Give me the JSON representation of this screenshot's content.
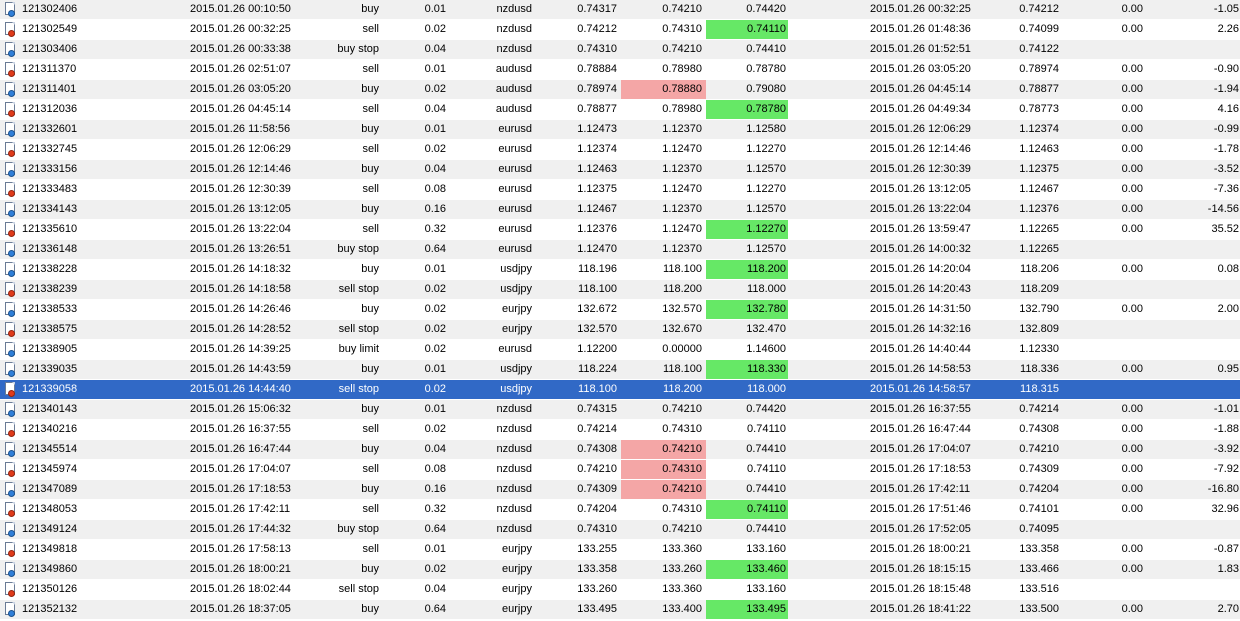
{
  "colors": {
    "row_even": "#f0f0f0",
    "row_odd": "#ffffff",
    "selected_row": "#3169c6",
    "highlight_red": "#f4a6a6",
    "highlight_green": "#66e866",
    "buy_icon": "#2f7fd8",
    "sell_icon": "#e03a1a"
  },
  "selected_ticket": "121339058",
  "rows": [
    {
      "icon": "buy",
      "ticket": "121302406",
      "open_time": "2015.01.26 00:10:50",
      "type": "buy",
      "size": "0.01",
      "symbol": "nzdusd",
      "price": "0.74317",
      "sl": "0.74210",
      "tp": "0.74420",
      "close_time": "2015.01.26 00:32:25",
      "close_price": "0.74212",
      "swap": "0.00",
      "profit": "-1.05",
      "sl_hl": "",
      "tp_hl": ""
    },
    {
      "icon": "sell",
      "ticket": "121302549",
      "open_time": "2015.01.26 00:32:25",
      "type": "sell",
      "size": "0.02",
      "symbol": "nzdusd",
      "price": "0.74212",
      "sl": "0.74310",
      "tp": "0.74110",
      "close_time": "2015.01.26 01:48:36",
      "close_price": "0.74099",
      "swap": "0.00",
      "profit": "2.26",
      "sl_hl": "",
      "tp_hl": "green"
    },
    {
      "icon": "buy",
      "ticket": "121303406",
      "open_time": "2015.01.26 00:33:38",
      "type": "buy stop",
      "size": "0.04",
      "symbol": "nzdusd",
      "price": "0.74310",
      "sl": "0.74210",
      "tp": "0.74410",
      "close_time": "2015.01.26 01:52:51",
      "close_price": "0.74122",
      "swap": "",
      "profit": "",
      "sl_hl": "",
      "tp_hl": ""
    },
    {
      "icon": "sell",
      "ticket": "121311370",
      "open_time": "2015.01.26 02:51:07",
      "type": "sell",
      "size": "0.01",
      "symbol": "audusd",
      "price": "0.78884",
      "sl": "0.78980",
      "tp": "0.78780",
      "close_time": "2015.01.26 03:05:20",
      "close_price": "0.78974",
      "swap": "0.00",
      "profit": "-0.90",
      "sl_hl": "",
      "tp_hl": ""
    },
    {
      "icon": "buy",
      "ticket": "121311401",
      "open_time": "2015.01.26 03:05:20",
      "type": "buy",
      "size": "0.02",
      "symbol": "audusd",
      "price": "0.78974",
      "sl": "0.78880",
      "tp": "0.79080",
      "close_time": "2015.01.26 04:45:14",
      "close_price": "0.78877",
      "swap": "0.00",
      "profit": "-1.94",
      "sl_hl": "red",
      "tp_hl": ""
    },
    {
      "icon": "sell",
      "ticket": "121312036",
      "open_time": "2015.01.26 04:45:14",
      "type": "sell",
      "size": "0.04",
      "symbol": "audusd",
      "price": "0.78877",
      "sl": "0.78980",
      "tp": "0.78780",
      "close_time": "2015.01.26 04:49:34",
      "close_price": "0.78773",
      "swap": "0.00",
      "profit": "4.16",
      "sl_hl": "",
      "tp_hl": "green"
    },
    {
      "icon": "buy",
      "ticket": "121332601",
      "open_time": "2015.01.26 11:58:56",
      "type": "buy",
      "size": "0.01",
      "symbol": "eurusd",
      "price": "1.12473",
      "sl": "1.12370",
      "tp": "1.12580",
      "close_time": "2015.01.26 12:06:29",
      "close_price": "1.12374",
      "swap": "0.00",
      "profit": "-0.99",
      "sl_hl": "",
      "tp_hl": ""
    },
    {
      "icon": "sell",
      "ticket": "121332745",
      "open_time": "2015.01.26 12:06:29",
      "type": "sell",
      "size": "0.02",
      "symbol": "eurusd",
      "price": "1.12374",
      "sl": "1.12470",
      "tp": "1.12270",
      "close_time": "2015.01.26 12:14:46",
      "close_price": "1.12463",
      "swap": "0.00",
      "profit": "-1.78",
      "sl_hl": "",
      "tp_hl": ""
    },
    {
      "icon": "buy",
      "ticket": "121333156",
      "open_time": "2015.01.26 12:14:46",
      "type": "buy",
      "size": "0.04",
      "symbol": "eurusd",
      "price": "1.12463",
      "sl": "1.12370",
      "tp": "1.12570",
      "close_time": "2015.01.26 12:30:39",
      "close_price": "1.12375",
      "swap": "0.00",
      "profit": "-3.52",
      "sl_hl": "",
      "tp_hl": ""
    },
    {
      "icon": "sell",
      "ticket": "121333483",
      "open_time": "2015.01.26 12:30:39",
      "type": "sell",
      "size": "0.08",
      "symbol": "eurusd",
      "price": "1.12375",
      "sl": "1.12470",
      "tp": "1.12270",
      "close_time": "2015.01.26 13:12:05",
      "close_price": "1.12467",
      "swap": "0.00",
      "profit": "-7.36",
      "sl_hl": "",
      "tp_hl": ""
    },
    {
      "icon": "buy",
      "ticket": "121334143",
      "open_time": "2015.01.26 13:12:05",
      "type": "buy",
      "size": "0.16",
      "symbol": "eurusd",
      "price": "1.12467",
      "sl": "1.12370",
      "tp": "1.12570",
      "close_time": "2015.01.26 13:22:04",
      "close_price": "1.12376",
      "swap": "0.00",
      "profit": "-14.56",
      "sl_hl": "",
      "tp_hl": ""
    },
    {
      "icon": "sell",
      "ticket": "121335610",
      "open_time": "2015.01.26 13:22:04",
      "type": "sell",
      "size": "0.32",
      "symbol": "eurusd",
      "price": "1.12376",
      "sl": "1.12470",
      "tp": "1.12270",
      "close_time": "2015.01.26 13:59:47",
      "close_price": "1.12265",
      "swap": "0.00",
      "profit": "35.52",
      "sl_hl": "",
      "tp_hl": "green"
    },
    {
      "icon": "buy",
      "ticket": "121336148",
      "open_time": "2015.01.26 13:26:51",
      "type": "buy stop",
      "size": "0.64",
      "symbol": "eurusd",
      "price": "1.12470",
      "sl": "1.12370",
      "tp": "1.12570",
      "close_time": "2015.01.26 14:00:32",
      "close_price": "1.12265",
      "swap": "",
      "profit": "",
      "sl_hl": "",
      "tp_hl": ""
    },
    {
      "icon": "buy",
      "ticket": "121338228",
      "open_time": "2015.01.26 14:18:32",
      "type": "buy",
      "size": "0.01",
      "symbol": "usdjpy",
      "price": "118.196",
      "sl": "118.100",
      "tp": "118.200",
      "close_time": "2015.01.26 14:20:04",
      "close_price": "118.206",
      "swap": "0.00",
      "profit": "0.08",
      "sl_hl": "",
      "tp_hl": "green"
    },
    {
      "icon": "sell",
      "ticket": "121338239",
      "open_time": "2015.01.26 14:18:58",
      "type": "sell stop",
      "size": "0.02",
      "symbol": "usdjpy",
      "price": "118.100",
      "sl": "118.200",
      "tp": "118.000",
      "close_time": "2015.01.26 14:20:43",
      "close_price": "118.209",
      "swap": "",
      "profit": "",
      "sl_hl": "",
      "tp_hl": ""
    },
    {
      "icon": "buy",
      "ticket": "121338533",
      "open_time": "2015.01.26 14:26:46",
      "type": "buy",
      "size": "0.02",
      "symbol": "eurjpy",
      "price": "132.672",
      "sl": "132.570",
      "tp": "132.780",
      "close_time": "2015.01.26 14:31:50",
      "close_price": "132.790",
      "swap": "0.00",
      "profit": "2.00",
      "sl_hl": "",
      "tp_hl": "green"
    },
    {
      "icon": "sell",
      "ticket": "121338575",
      "open_time": "2015.01.26 14:28:52",
      "type": "sell stop",
      "size": "0.02",
      "symbol": "eurjpy",
      "price": "132.570",
      "sl": "132.670",
      "tp": "132.470",
      "close_time": "2015.01.26 14:32:16",
      "close_price": "132.809",
      "swap": "",
      "profit": "",
      "sl_hl": "",
      "tp_hl": ""
    },
    {
      "icon": "buy",
      "ticket": "121338905",
      "open_time": "2015.01.26 14:39:25",
      "type": "buy limit",
      "size": "0.02",
      "symbol": "eurusd",
      "price": "1.12200",
      "sl": "0.00000",
      "tp": "1.14600",
      "close_time": "2015.01.26 14:40:44",
      "close_price": "1.12330",
      "swap": "",
      "profit": "",
      "sl_hl": "",
      "tp_hl": ""
    },
    {
      "icon": "buy",
      "ticket": "121339035",
      "open_time": "2015.01.26 14:43:59",
      "type": "buy",
      "size": "0.01",
      "symbol": "usdjpy",
      "price": "118.224",
      "sl": "118.100",
      "tp": "118.330",
      "close_time": "2015.01.26 14:58:53",
      "close_price": "118.336",
      "swap": "0.00",
      "profit": "0.95",
      "sl_hl": "",
      "tp_hl": "green"
    },
    {
      "icon": "sell",
      "ticket": "121339058",
      "open_time": "2015.01.26 14:44:40",
      "type": "sell stop",
      "size": "0.02",
      "symbol": "usdjpy",
      "price": "118.100",
      "sl": "118.200",
      "tp": "118.000",
      "close_time": "2015.01.26 14:58:57",
      "close_price": "118.315",
      "swap": "",
      "profit": "",
      "sl_hl": "",
      "tp_hl": ""
    },
    {
      "icon": "buy",
      "ticket": "121340143",
      "open_time": "2015.01.26 15:06:32",
      "type": "buy",
      "size": "0.01",
      "symbol": "nzdusd",
      "price": "0.74315",
      "sl": "0.74210",
      "tp": "0.74420",
      "close_time": "2015.01.26 16:37:55",
      "close_price": "0.74214",
      "swap": "0.00",
      "profit": "-1.01",
      "sl_hl": "",
      "tp_hl": ""
    },
    {
      "icon": "sell",
      "ticket": "121340216",
      "open_time": "2015.01.26 16:37:55",
      "type": "sell",
      "size": "0.02",
      "symbol": "nzdusd",
      "price": "0.74214",
      "sl": "0.74310",
      "tp": "0.74110",
      "close_time": "2015.01.26 16:47:44",
      "close_price": "0.74308",
      "swap": "0.00",
      "profit": "-1.88",
      "sl_hl": "",
      "tp_hl": ""
    },
    {
      "icon": "buy",
      "ticket": "121345514",
      "open_time": "2015.01.26 16:47:44",
      "type": "buy",
      "size": "0.04",
      "symbol": "nzdusd",
      "price": "0.74308",
      "sl": "0.74210",
      "tp": "0.74410",
      "close_time": "2015.01.26 17:04:07",
      "close_price": "0.74210",
      "swap": "0.00",
      "profit": "-3.92",
      "sl_hl": "red",
      "tp_hl": ""
    },
    {
      "icon": "sell",
      "ticket": "121345974",
      "open_time": "2015.01.26 17:04:07",
      "type": "sell",
      "size": "0.08",
      "symbol": "nzdusd",
      "price": "0.74210",
      "sl": "0.74310",
      "tp": "0.74110",
      "close_time": "2015.01.26 17:18:53",
      "close_price": "0.74309",
      "swap": "0.00",
      "profit": "-7.92",
      "sl_hl": "red",
      "tp_hl": ""
    },
    {
      "icon": "buy",
      "ticket": "121347089",
      "open_time": "2015.01.26 17:18:53",
      "type": "buy",
      "size": "0.16",
      "symbol": "nzdusd",
      "price": "0.74309",
      "sl": "0.74210",
      "tp": "0.74410",
      "close_time": "2015.01.26 17:42:11",
      "close_price": "0.74204",
      "swap": "0.00",
      "profit": "-16.80",
      "sl_hl": "red",
      "tp_hl": ""
    },
    {
      "icon": "sell",
      "ticket": "121348053",
      "open_time": "2015.01.26 17:42:11",
      "type": "sell",
      "size": "0.32",
      "symbol": "nzdusd",
      "price": "0.74204",
      "sl": "0.74310",
      "tp": "0.74110",
      "close_time": "2015.01.26 17:51:46",
      "close_price": "0.74101",
      "swap": "0.00",
      "profit": "32.96",
      "sl_hl": "",
      "tp_hl": "green"
    },
    {
      "icon": "buy",
      "ticket": "121349124",
      "open_time": "2015.01.26 17:44:32",
      "type": "buy stop",
      "size": "0.64",
      "symbol": "nzdusd",
      "price": "0.74310",
      "sl": "0.74210",
      "tp": "0.74410",
      "close_time": "2015.01.26 17:52:05",
      "close_price": "0.74095",
      "swap": "",
      "profit": "",
      "sl_hl": "",
      "tp_hl": ""
    },
    {
      "icon": "sell",
      "ticket": "121349818",
      "open_time": "2015.01.26 17:58:13",
      "type": "sell",
      "size": "0.01",
      "symbol": "eurjpy",
      "price": "133.255",
      "sl": "133.360",
      "tp": "133.160",
      "close_time": "2015.01.26 18:00:21",
      "close_price": "133.358",
      "swap": "0.00",
      "profit": "-0.87",
      "sl_hl": "",
      "tp_hl": ""
    },
    {
      "icon": "buy",
      "ticket": "121349860",
      "open_time": "2015.01.26 18:00:21",
      "type": "buy",
      "size": "0.02",
      "symbol": "eurjpy",
      "price": "133.358",
      "sl": "133.260",
      "tp": "133.460",
      "close_time": "2015.01.26 18:15:15",
      "close_price": "133.466",
      "swap": "0.00",
      "profit": "1.83",
      "sl_hl": "",
      "tp_hl": "green"
    },
    {
      "icon": "sell",
      "ticket": "121350126",
      "open_time": "2015.01.26 18:02:44",
      "type": "sell stop",
      "size": "0.04",
      "symbol": "eurjpy",
      "price": "133.260",
      "sl": "133.360",
      "tp": "133.160",
      "close_time": "2015.01.26 18:15:48",
      "close_price": "133.516",
      "swap": "",
      "profit": "",
      "sl_hl": "",
      "tp_hl": ""
    },
    {
      "icon": "buy",
      "ticket": "121352132",
      "open_time": "2015.01.26 18:37:05",
      "type": "buy",
      "size": "0.64",
      "symbol": "eurjpy",
      "price": "133.495",
      "sl": "133.400",
      "tp": "133.495",
      "close_time": "2015.01.26 18:41:22",
      "close_price": "133.500",
      "swap": "0.00",
      "profit": "2.70",
      "sl_hl": "",
      "tp_hl": "green"
    }
  ]
}
